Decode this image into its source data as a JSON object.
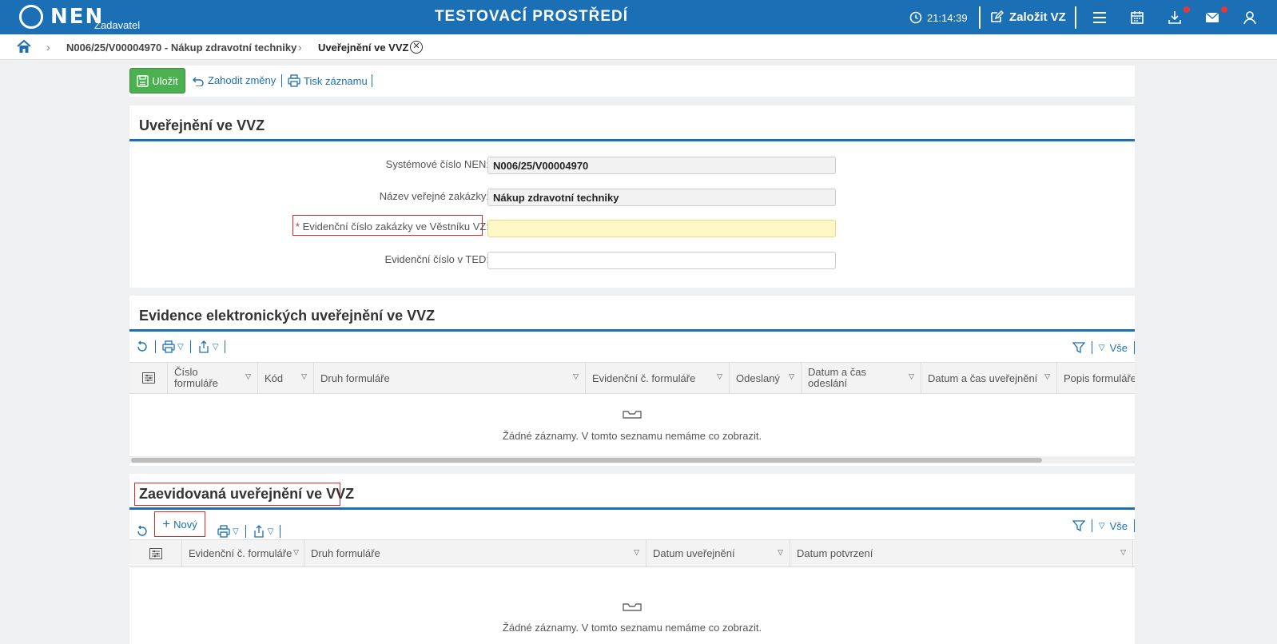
{
  "header": {
    "logo_text": "NEN",
    "logo_sub": "Zadavatel",
    "env_title": "TESTOVACÍ PROSTŘEDÍ",
    "clock": "21:14:39",
    "create_label": "Založit VZ"
  },
  "breadcrumb": {
    "items": [
      "N006/25/V00004970 - Nákup zdravotní techniky",
      "Uveřejnění ve VVZ"
    ]
  },
  "toolbar": {
    "save_label": "Uložit",
    "discard_label": "Zahodit změny",
    "print_label": "Tisk záznamu"
  },
  "form_section": {
    "title": "Uveřejnění ve VVZ",
    "fields": [
      {
        "label": "Systémové číslo NEN:",
        "value": "N006/25/V00004970"
      },
      {
        "label": "Název veřejné zakázky:",
        "value": "Nákup zdravotní techniky"
      },
      {
        "label": "Evidenční číslo zakázky ve Věstníku VZ:",
        "value": "",
        "required_mark": "*"
      },
      {
        "label": "Evidenční číslo v TED:",
        "value": ""
      }
    ]
  },
  "grid1": {
    "title": "Evidence elektronických uveřejnění ve VVZ",
    "filter_all": "Vše",
    "columns": [
      "Číslo formuláře",
      "Kód",
      "Druh formuláře",
      "Evidenční č. formuláře",
      "Odeslaný",
      "Datum a čas odeslání",
      "Datum a čas uveřejnění",
      "Popis formuláře"
    ],
    "empty_text": "Žádné záznamy. V tomto seznamu nemáme co zobrazit."
  },
  "grid2": {
    "title": "Zaevidovaná uveřejnění ve VVZ",
    "new_label": "Nový",
    "filter_all": "Vše",
    "columns": [
      "Evidenční č. formuláře",
      "Druh formuláře",
      "Datum uveřejnění",
      "Datum potvrzení"
    ],
    "empty_text": "Žádné záznamy. V tomto seznamu nemáme co zobrazit."
  },
  "colors": {
    "brand": "#1b6fb5",
    "save": "#4caf50",
    "required_bg": "#fff7c4",
    "highlight": "#d32f2f"
  }
}
